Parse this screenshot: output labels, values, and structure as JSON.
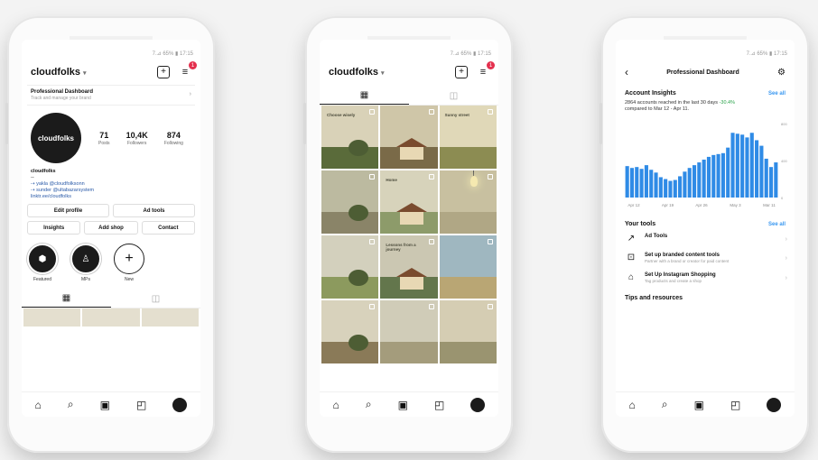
{
  "common": {
    "status_left": "",
    "status_right": "7.⊿ 65% ▮ 17:15",
    "username": "cloudfolks",
    "notif_count": "1"
  },
  "phone1": {
    "dashboard_title": "Professional Dashboard",
    "dashboard_sub": "Track and manage your brand",
    "avatar_text": "cloudfolks",
    "stats": [
      {
        "n": "71",
        "l": "Posts"
      },
      {
        "n": "10,4K",
        "l": "Followers"
      },
      {
        "n": "874",
        "l": "Following"
      }
    ],
    "bio_name": "cloudfolks",
    "bio_lines": [
      "--",
      "⇢ yakla @cloudfolksonn",
      "⇢ sunder @ultabazarsystem",
      "linktr.ee/cloudfolks"
    ],
    "buttons_row1": [
      "Edit profile",
      "Ad tools"
    ],
    "buttons_row2": [
      "Insights",
      "Add shop",
      "Contact"
    ],
    "highlights": [
      {
        "label": "Featured",
        "glyph": "⬢"
      },
      {
        "label": "MPs",
        "glyph": "♙"
      },
      {
        "label": "New",
        "glyph": "+"
      }
    ]
  },
  "phone2": {
    "tiles": [
      {
        "caption": "Choose wisely",
        "bg": "#d9d2b8",
        "ground": "#5a6b3a"
      },
      {
        "caption": "",
        "bg": "#cfc6a8",
        "ground": "#7a6a48"
      },
      {
        "caption": "Sunny street",
        "bg": "#e0d8b8",
        "ground": "#8c8c52"
      },
      {
        "caption": "",
        "bg": "#bcbaa0",
        "ground": "#8a8468"
      },
      {
        "caption": "Home",
        "bg": "#d7d3bb",
        "ground": "#8d9b6a"
      },
      {
        "caption": "",
        "bg": "#c8c0a0",
        "ground": "#b0a785"
      },
      {
        "caption": "",
        "bg": "#d3d0bd",
        "ground": "#8c9a5e"
      },
      {
        "caption": "Lessons from a journey",
        "bg": "#cbc7b2",
        "ground": "#63764c"
      },
      {
        "caption": "",
        "bg": "#9fb7c0",
        "ground": "#b9a674"
      },
      {
        "caption": "",
        "bg": "#d8d2bc",
        "ground": "#8a7a58"
      },
      {
        "caption": "",
        "bg": "#d0ccb8",
        "ground": "#a49c7c"
      },
      {
        "caption": "",
        "bg": "#d5cdb3",
        "ground": "#9a9470"
      }
    ]
  },
  "phone3": {
    "title": "Professional Dashboard",
    "insights_title": "Account Insights",
    "see_all": "See all",
    "insight_text": "2864 accounts reached in the last 30 days",
    "insight_pct": "-30.4%",
    "insight_range": "compared to Mar 12 - Apr 11.",
    "x_labels": [
      "Apr 12",
      "Apr 19",
      "Apr 26",
      "May 3",
      "Mar 11"
    ],
    "y_labels": [
      "800",
      "400",
      "0"
    ],
    "tools_title": "Your tools",
    "tools": [
      {
        "icon": "↗",
        "title": "Ad Tools",
        "sub": ""
      },
      {
        "icon": "⊡",
        "title": "Set up branded content tools",
        "sub": "Partner with a brand or creator for paid content"
      },
      {
        "icon": "⌂",
        "title": "Set Up Instagram Shopping",
        "sub": "Tag products and create a shop"
      }
    ],
    "tips_title": "Tips and resources"
  },
  "chart_data": {
    "type": "bar",
    "title": "",
    "xlabel": "",
    "ylabel": "",
    "x": [
      "Apr 12",
      "Apr 19",
      "Apr 26",
      "May 3",
      "Mar 11"
    ],
    "values": [
      340,
      320,
      330,
      310,
      350,
      300,
      270,
      220,
      200,
      180,
      190,
      230,
      280,
      320,
      350,
      380,
      410,
      440,
      460,
      470,
      480,
      540,
      700,
      690,
      680,
      650,
      700,
      620,
      560,
      420,
      330,
      380
    ],
    "ylim": [
      0,
      800
    ],
    "color": "#2f8be6",
    "grid": false
  }
}
